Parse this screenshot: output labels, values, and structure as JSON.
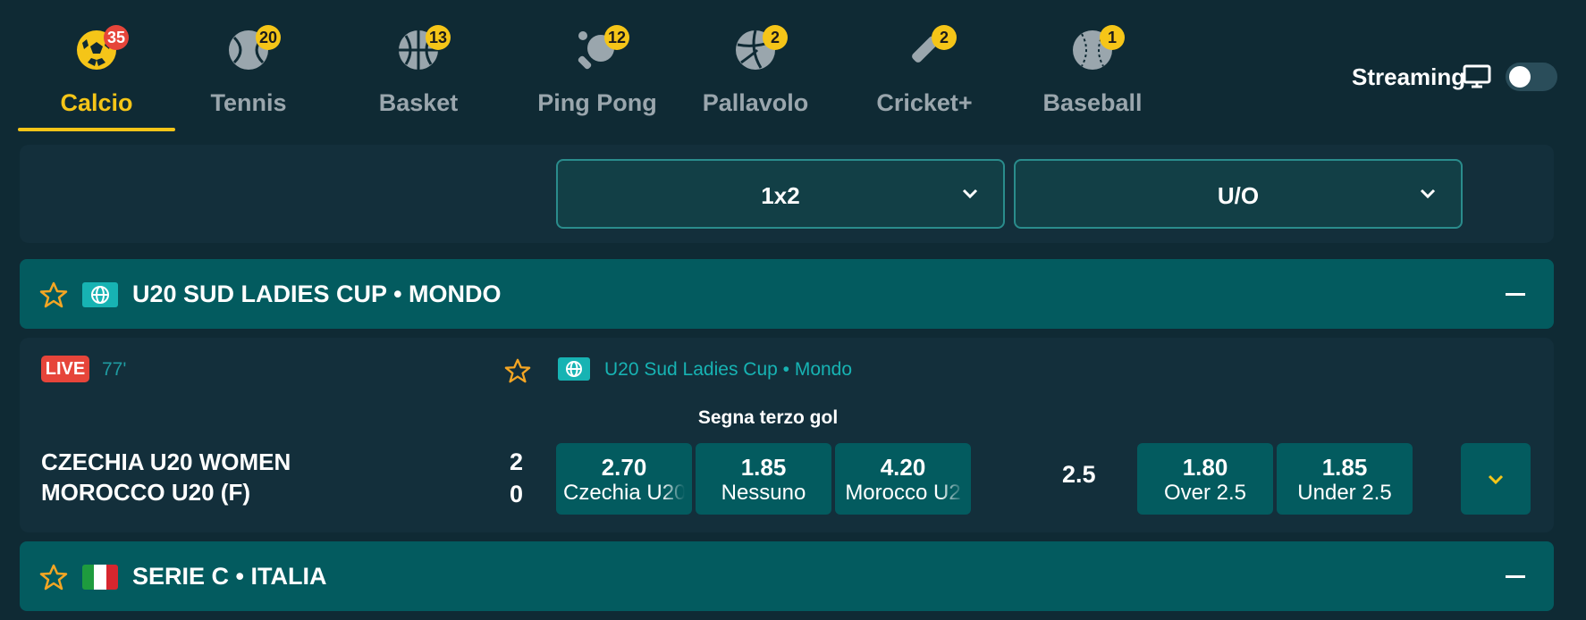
{
  "sports": [
    {
      "label": "Calcio",
      "count": "35",
      "icon": "soccer-ball-icon",
      "active": true
    },
    {
      "label": "Tennis",
      "count": "20",
      "icon": "tennis-ball-icon",
      "active": false
    },
    {
      "label": "Basket",
      "count": "13",
      "icon": "basketball-icon",
      "active": false
    },
    {
      "label": "Ping Pong",
      "count": "12",
      "icon": "ping-pong-paddle-icon",
      "active": false
    },
    {
      "label": "Pallavolo",
      "count": "2",
      "icon": "volleyball-icon",
      "active": false
    },
    {
      "label": "Cricket+",
      "count": "2",
      "icon": "cricket-bat-icon",
      "active": false
    },
    {
      "label": "Baseball",
      "count": "1",
      "icon": "baseball-icon",
      "active": false
    }
  ],
  "streaming": {
    "label": "Streaming",
    "icon": "monitor-icon",
    "enabled": false
  },
  "markets": {
    "primary": "1x2",
    "secondary": "U/O"
  },
  "leagues": [
    {
      "name": "U20 SUD LADIES CUP • MONDO",
      "flag": "globe-icon"
    },
    {
      "name": "SERIE C • ITALIA",
      "flag": "italy-flag-icon"
    }
  ],
  "event": {
    "live_label": "LIVE",
    "minute": "77'",
    "competition": "U20 Sud Ladies Cup • Mondo",
    "market_title": "Segna terzo gol",
    "home": {
      "name": "CZECHIA U20 WOMEN",
      "score": "2"
    },
    "away": {
      "name": "MOROCCO U20 (F)",
      "score": "0"
    },
    "odds_1x2": [
      {
        "price": "2.70",
        "label": "Czechia U20"
      },
      {
        "price": "1.85",
        "label": "Nessuno"
      },
      {
        "price": "4.20",
        "label": "Morocco U2"
      }
    ],
    "line": "2.5",
    "odds_uo": [
      {
        "price": "1.80",
        "label": "Over 2.5"
      },
      {
        "price": "1.85",
        "label": "Under 2.5"
      }
    ]
  },
  "colors": {
    "accent": "#f5c518",
    "live": "#e6453a",
    "teal": "#035b5f",
    "background": "#0f2a34"
  }
}
